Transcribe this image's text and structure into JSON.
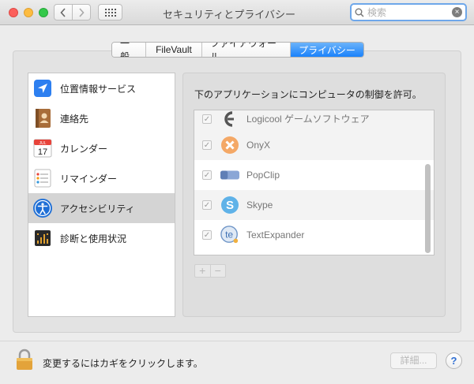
{
  "window": {
    "title": "セキュリティとプライバシー"
  },
  "toolbar": {
    "back_icon": "chevron-left-icon",
    "forward_icon": "chevron-right-icon",
    "show_all_icon": "grid-icon"
  },
  "search": {
    "placeholder": "検索",
    "value": ""
  },
  "tabs": [
    {
      "label": "一般",
      "active": false
    },
    {
      "label": "FileVault",
      "active": false
    },
    {
      "label": "ファイアウォール",
      "active": false
    },
    {
      "label": "プライバシー",
      "active": true
    }
  ],
  "sidebar": {
    "items": [
      {
        "label": "位置情報サービス",
        "icon": "location-icon",
        "selected": false
      },
      {
        "label": "連絡先",
        "icon": "contacts-icon",
        "selected": false
      },
      {
        "label": "カレンダー",
        "icon": "calendar-icon",
        "calendar_month": "JUL",
        "calendar_day": "17",
        "selected": false
      },
      {
        "label": "リマインダー",
        "icon": "reminders-icon",
        "selected": false
      },
      {
        "label": "アクセシビリティ",
        "icon": "accessibility-icon",
        "selected": true
      },
      {
        "label": "診断と使用状況",
        "icon": "diagnostics-icon",
        "selected": false
      }
    ]
  },
  "main": {
    "heading": "下のアプリケーションにコンピュータの制御を許可。",
    "apps": [
      {
        "name": "Logicool ゲームソフトウェア",
        "checked": true,
        "icon": "logicool-icon"
      },
      {
        "name": "OnyX",
        "checked": true,
        "icon": "onyx-icon"
      },
      {
        "name": "PopClip",
        "checked": true,
        "icon": "popclip-icon"
      },
      {
        "name": "Skype",
        "checked": true,
        "icon": "skype-icon"
      },
      {
        "name": "TextExpander",
        "checked": true,
        "icon": "textexpander-icon"
      }
    ],
    "add_label": "+",
    "remove_label": "−"
  },
  "footer": {
    "lock_text": "変更するにはカギをクリックします。",
    "detail_button": "詳細...",
    "help_label": "?"
  },
  "colors": {
    "accent": "#1a82fb",
    "selection": "#d4d4d4"
  }
}
